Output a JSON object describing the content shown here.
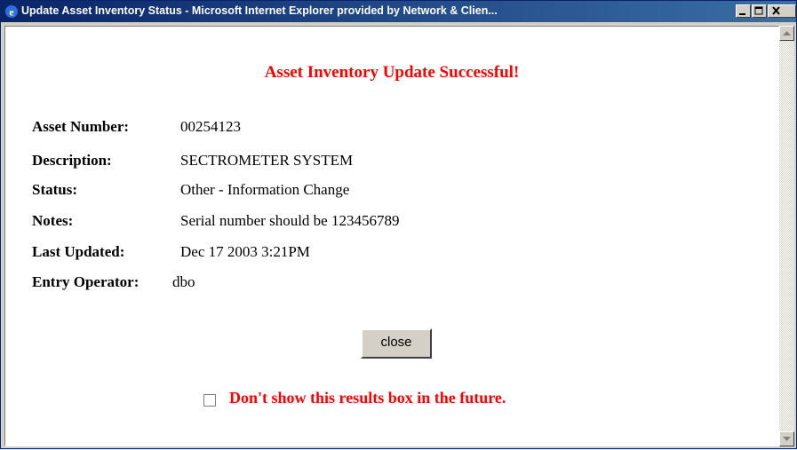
{
  "window": {
    "title": "Update Asset Inventory Status - Microsoft Internet Explorer provided by Network & Clien..."
  },
  "heading": "Asset Inventory Update Successful!",
  "fields": [
    {
      "label": "Asset Number:",
      "value": "00254123"
    },
    {
      "label": "Description:",
      "value": "SECTROMETER SYSTEM"
    },
    {
      "label": "Status:",
      "value": "Other - Information Change"
    },
    {
      "label": "Notes:",
      "value": "Serial number should be 123456789"
    },
    {
      "label": "Last Updated:",
      "value": "Dec 17 2003 3:21PM"
    },
    {
      "label": "Entry Operator:",
      "value": "dbo"
    }
  ],
  "close_label": "close",
  "checkbox_label": "Don't show this results box in the future.",
  "colors": {
    "accent": "#ff0000",
    "titlebar": "#0a246a"
  }
}
